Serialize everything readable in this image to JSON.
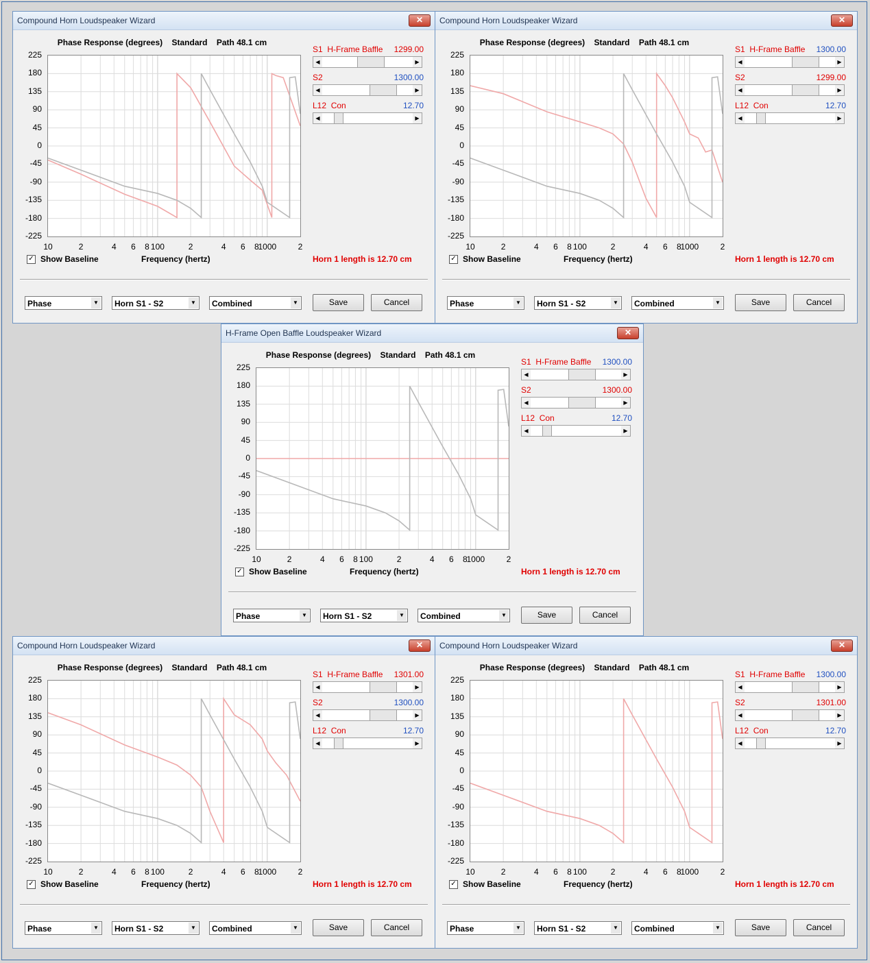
{
  "windows": [
    {
      "title": "Compound Horn Loudspeaker Wizard",
      "close": "✕",
      "header": {
        "chart": "Phase Response (degrees)",
        "mode": "Standard",
        "path": "Path 48.1 cm"
      },
      "controls": {
        "s1": {
          "label": "S1  H-Frame Baffle",
          "value": "1299.00",
          "value_color": "#e00000",
          "position": 0.55
        },
        "s2": {
          "label": "S2",
          "value": "1300.00",
          "value_color": "#2050c0",
          "position": 0.75
        },
        "l12": {
          "label": "L12  Con",
          "value": "12.70",
          "value_color": "#2050c0",
          "position": 0.14
        }
      },
      "show_baseline_label": "Show Baseline",
      "show_baseline_checked": true,
      "horn_length_text": "Horn 1 length is 12.70 cm",
      "dropdowns": [
        "Phase",
        "Horn S1 - S2",
        "Combined"
      ],
      "buttons": {
        "save": "Save",
        "cancel": "Cancel"
      },
      "chart_data": {
        "type": "line",
        "xlabel": "Frequency (hertz)",
        "yticks": [
          "225",
          "180",
          "135",
          "90",
          "45",
          "0",
          "-45",
          "-90",
          "-135",
          "-180",
          "-225"
        ],
        "xticks": [
          "10",
          "2",
          "4",
          "6",
          "8",
          "100",
          "2",
          "4",
          "6",
          "8",
          "1000",
          "2"
        ],
        "x_scale": "log",
        "xlim": [
          10,
          2000
        ],
        "ylim": [
          -225,
          225
        ],
        "grid": true,
        "series": [
          {
            "color": "#f0a8a8",
            "x": [
              10,
              20,
              50,
              100,
              150,
              150,
              200,
              300,
              500,
              700,
              900,
              1100,
              1100,
              1200,
              1400,
              2000
            ],
            "y": [
              -35,
              -70,
              -120,
              -150,
              -178,
              180,
              145,
              60,
              -50,
              -85,
              -110,
              -178,
              180,
              175,
              170,
              50
            ]
          },
          {
            "color": "#b8b8b8",
            "x": [
              10,
              20,
              50,
              100,
              150,
              200,
              250,
              250,
              300,
              500,
              700,
              900,
              1000,
              1600,
              1600,
              1800,
              2000
            ],
            "y": [
              -30,
              -60,
              -100,
              -118,
              -135,
              -155,
              -178,
              180,
              140,
              30,
              -40,
              -100,
              -140,
              -178,
              170,
              172,
              80
            ]
          }
        ]
      }
    },
    {
      "title": "Compound Horn Loudspeaker Wizard",
      "close": "✕",
      "header": {
        "chart": "Phase Response (degrees)",
        "mode": "Standard",
        "path": "Path 48.1 cm"
      },
      "controls": {
        "s1": {
          "label": "S1  H-Frame Baffle",
          "value": "1300.00",
          "value_color": "#2050c0",
          "position": 0.75
        },
        "s2": {
          "label": "S2",
          "value": "1299.00",
          "value_color": "#e00000",
          "position": 0.75
        },
        "l12": {
          "label": "L12  Con",
          "value": "12.70",
          "value_color": "#2050c0",
          "position": 0.14
        }
      },
      "show_baseline_label": "Show Baseline",
      "show_baseline_checked": true,
      "horn_length_text": "Horn 1 length is 12.70 cm",
      "dropdowns": [
        "Phase",
        "Horn S1 - S2",
        "Combined"
      ],
      "buttons": {
        "save": "Save",
        "cancel": "Cancel"
      },
      "chart_data": {
        "type": "line",
        "xlabel": "Frequency (hertz)",
        "yticks": [
          "225",
          "180",
          "135",
          "90",
          "45",
          "0",
          "-45",
          "-90",
          "-135",
          "-180",
          "-225"
        ],
        "xticks": [
          "10",
          "2",
          "4",
          "6",
          "8",
          "100",
          "2",
          "4",
          "6",
          "8",
          "1000",
          "2"
        ],
        "x_scale": "log",
        "xlim": [
          10,
          2000
        ],
        "ylim": [
          -225,
          225
        ],
        "grid": true,
        "series": [
          {
            "color": "#f0a8a8",
            "x": [
              10,
              20,
              50,
              100,
              150,
              200,
              250,
              300,
              400,
              500,
              500,
              600,
              700,
              900,
              1000,
              1200,
              1400,
              1600,
              2000
            ],
            "y": [
              150,
              130,
              85,
              60,
              45,
              30,
              5,
              -40,
              -130,
              -178,
              180,
              150,
              120,
              60,
              30,
              20,
              -15,
              -10,
              -90
            ]
          },
          {
            "color": "#b8b8b8",
            "x": [
              10,
              20,
              50,
              100,
              150,
              200,
              250,
              250,
              300,
              500,
              700,
              900,
              1000,
              1600,
              1600,
              1800,
              2000
            ],
            "y": [
              -30,
              -60,
              -100,
              -118,
              -135,
              -155,
              -178,
              180,
              140,
              30,
              -40,
              -100,
              -140,
              -178,
              170,
              172,
              80
            ]
          }
        ]
      }
    },
    {
      "title": "H-Frame Open Baffle Loudspeaker Wizard",
      "close": "✕",
      "header": {
        "chart": "Phase Response (degrees)",
        "mode": "Standard",
        "path": "Path 48.1 cm"
      },
      "controls": {
        "s1": {
          "label": "S1  H-Frame Baffle",
          "value": "1300.00",
          "value_color": "#2050c0",
          "position": 0.6
        },
        "s2": {
          "label": "S2",
          "value": "1300.00",
          "value_color": "#e00000",
          "position": 0.6
        },
        "l12": {
          "label": "L12  Con",
          "value": "12.70",
          "value_color": "#2050c0",
          "position": 0.14
        }
      },
      "show_baseline_label": "Show Baseline",
      "show_baseline_checked": true,
      "horn_length_text": "Horn 1 length is 12.70 cm",
      "dropdowns": [
        "Phase",
        "Horn S1 - S2",
        "Combined"
      ],
      "buttons": {
        "save": "Save",
        "cancel": "Cancel"
      },
      "chart_data": {
        "type": "line",
        "xlabel": "Frequency (hertz)",
        "yticks": [
          "225",
          "180",
          "135",
          "90",
          "45",
          "0",
          "-45",
          "-90",
          "-135",
          "-180",
          "-225"
        ],
        "xticks": [
          "10",
          "2",
          "4",
          "6",
          "8",
          "100",
          "2",
          "4",
          "6",
          "8",
          "1000",
          "2"
        ],
        "x_scale": "log",
        "xlim": [
          10,
          2000
        ],
        "ylim": [
          -225,
          225
        ],
        "grid": true,
        "series": [
          {
            "color": "#f0a8a8",
            "x": [
              10,
              2000
            ],
            "y": [
              0,
              0
            ]
          },
          {
            "color": "#b8b8b8",
            "x": [
              10,
              20,
              50,
              100,
              150,
              200,
              250,
              250,
              300,
              500,
              700,
              900,
              1000,
              1600,
              1600,
              1800,
              2000
            ],
            "y": [
              -30,
              -60,
              -100,
              -118,
              -135,
              -155,
              -178,
              180,
              140,
              30,
              -40,
              -100,
              -140,
              -178,
              170,
              172,
              80
            ]
          }
        ]
      }
    },
    {
      "title": "Compound Horn Loudspeaker Wizard",
      "close": "✕",
      "header": {
        "chart": "Phase Response (degrees)",
        "mode": "Standard",
        "path": "Path 48.1 cm"
      },
      "controls": {
        "s1": {
          "label": "S1  H-Frame Baffle",
          "value": "1301.00",
          "value_color": "#e00000",
          "position": 0.75
        },
        "s2": {
          "label": "S2",
          "value": "1300.00",
          "value_color": "#2050c0",
          "position": 0.75
        },
        "l12": {
          "label": "L12  Con",
          "value": "12.70",
          "value_color": "#2050c0",
          "position": 0.14
        }
      },
      "show_baseline_label": "Show Baseline",
      "show_baseline_checked": true,
      "horn_length_text": "Horn 1 length is 12.70 cm",
      "dropdowns": [
        "Phase",
        "Horn S1 - S2",
        "Combined"
      ],
      "buttons": {
        "save": "Save",
        "cancel": "Cancel"
      },
      "chart_data": {
        "type": "line",
        "xlabel": "Frequency (hertz)",
        "yticks": [
          "225",
          "180",
          "135",
          "90",
          "45",
          "0",
          "-45",
          "-90",
          "-135",
          "-180",
          "-225"
        ],
        "xticks": [
          "10",
          "2",
          "4",
          "6",
          "8",
          "100",
          "2",
          "4",
          "6",
          "8",
          "1000",
          "2"
        ],
        "x_scale": "log",
        "xlim": [
          10,
          2000
        ],
        "ylim": [
          -225,
          225
        ],
        "grid": true,
        "series": [
          {
            "color": "#f0a8a8",
            "x": [
              10,
              20,
              50,
              100,
              150,
              200,
              250,
              300,
              400,
              400,
              500,
              700,
              900,
              1000,
              1200,
              1500,
              2000
            ],
            "y": [
              145,
              115,
              65,
              35,
              15,
              -10,
              -40,
              -100,
              -178,
              180,
              140,
              115,
              80,
              50,
              20,
              -10,
              -75
            ]
          },
          {
            "color": "#b8b8b8",
            "x": [
              10,
              20,
              50,
              100,
              150,
              200,
              250,
              250,
              300,
              500,
              700,
              900,
              1000,
              1600,
              1600,
              1800,
              2000
            ],
            "y": [
              -30,
              -60,
              -100,
              -118,
              -135,
              -155,
              -178,
              180,
              140,
              30,
              -40,
              -100,
              -140,
              -178,
              170,
              172,
              80
            ]
          }
        ]
      }
    },
    {
      "title": "Compound Horn Loudspeaker Wizard",
      "close": "✕",
      "header": {
        "chart": "Phase Response (degrees)",
        "mode": "Standard",
        "path": "Path 48.1 cm"
      },
      "controls": {
        "s1": {
          "label": "S1  H-Frame Baffle",
          "value": "1300.00",
          "value_color": "#2050c0",
          "position": 0.75
        },
        "s2": {
          "label": "S2",
          "value": "1301.00",
          "value_color": "#e00000",
          "position": 0.75
        },
        "l12": {
          "label": "L12  Con",
          "value": "12.70",
          "value_color": "#2050c0",
          "position": 0.14
        }
      },
      "show_baseline_label": "Show Baseline",
      "show_baseline_checked": true,
      "horn_length_text": "Horn 1 length is 12.70 cm",
      "dropdowns": [
        "Phase",
        "Horn S1 - S2",
        "Combined"
      ],
      "buttons": {
        "save": "Save",
        "cancel": "Cancel"
      },
      "chart_data": {
        "type": "line",
        "xlabel": "Frequency (hertz)",
        "yticks": [
          "225",
          "180",
          "135",
          "90",
          "45",
          "0",
          "-45",
          "-90",
          "-135",
          "-180",
          "-225"
        ],
        "xticks": [
          "10",
          "2",
          "4",
          "6",
          "8",
          "100",
          "2",
          "4",
          "6",
          "8",
          "1000",
          "2"
        ],
        "x_scale": "log",
        "xlim": [
          10,
          2000
        ],
        "ylim": [
          -225,
          225
        ],
        "grid": true,
        "series": [
          {
            "color": "#f0a8a8",
            "x": [
              10,
              20,
              50,
              100,
              150,
              200,
              250,
              250,
              300,
              500,
              700,
              900,
              1000,
              1600,
              1600,
              1800,
              2000
            ],
            "y": [
              -30,
              -60,
              -100,
              -118,
              -135,
              -155,
              -178,
              180,
              140,
              30,
              -40,
              -100,
              -140,
              -178,
              170,
              172,
              80
            ]
          }
        ]
      }
    }
  ]
}
